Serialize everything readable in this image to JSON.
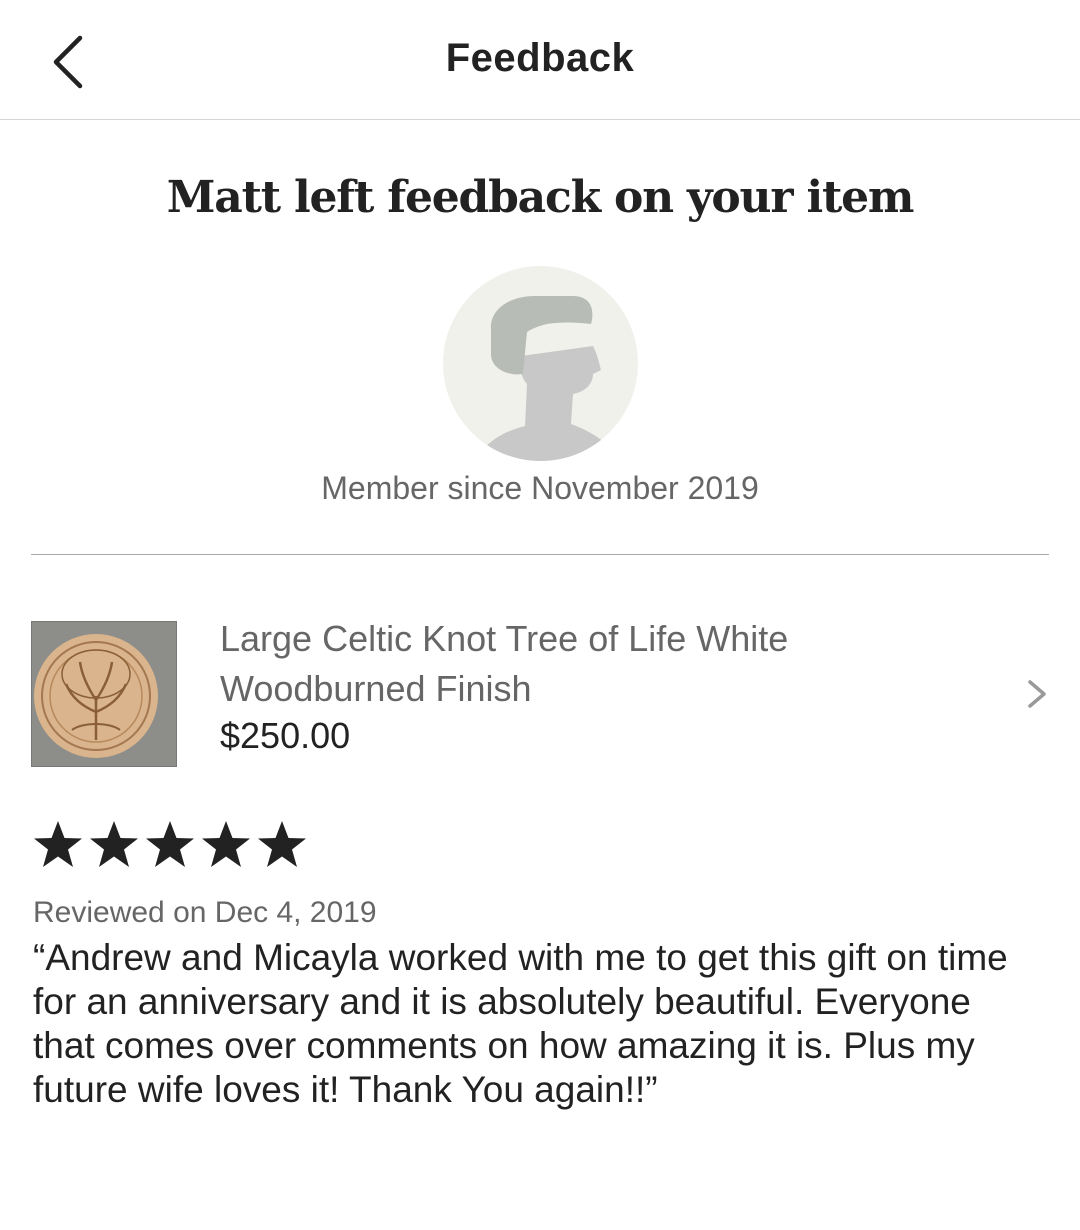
{
  "header": {
    "title": "Feedback",
    "back_icon": "chevron-left-icon"
  },
  "feedback": {
    "headline": "Matt left feedback on your item",
    "reviewer_avatar": "default-avatar-silhouette",
    "member_since": "Member since November 2019"
  },
  "item": {
    "title": "Large Celtic Knot Tree of Life White Woodburned Finish",
    "price": "$250.00",
    "thumbnail": "celtic-tree-of-life-wood-plaque",
    "chevron_icon": "chevron-right-icon"
  },
  "review": {
    "rating": 5,
    "rating_max": 5,
    "date": "Reviewed on Dec 4, 2019",
    "text": "“Andrew and Micayla worked with me to get this gift on time for an anniversary and it is absolutely beautiful. Everyone that comes over comments on how amazing it is. Plus my future wife loves it! Thank You again!!”"
  },
  "colors": {
    "text_primary": "#222222",
    "text_secondary": "#666666",
    "divider": "#a9a9a9",
    "avatar_bg": "#f1f1ec",
    "avatar_figure": "#c8c8c8",
    "star": "#222222"
  }
}
